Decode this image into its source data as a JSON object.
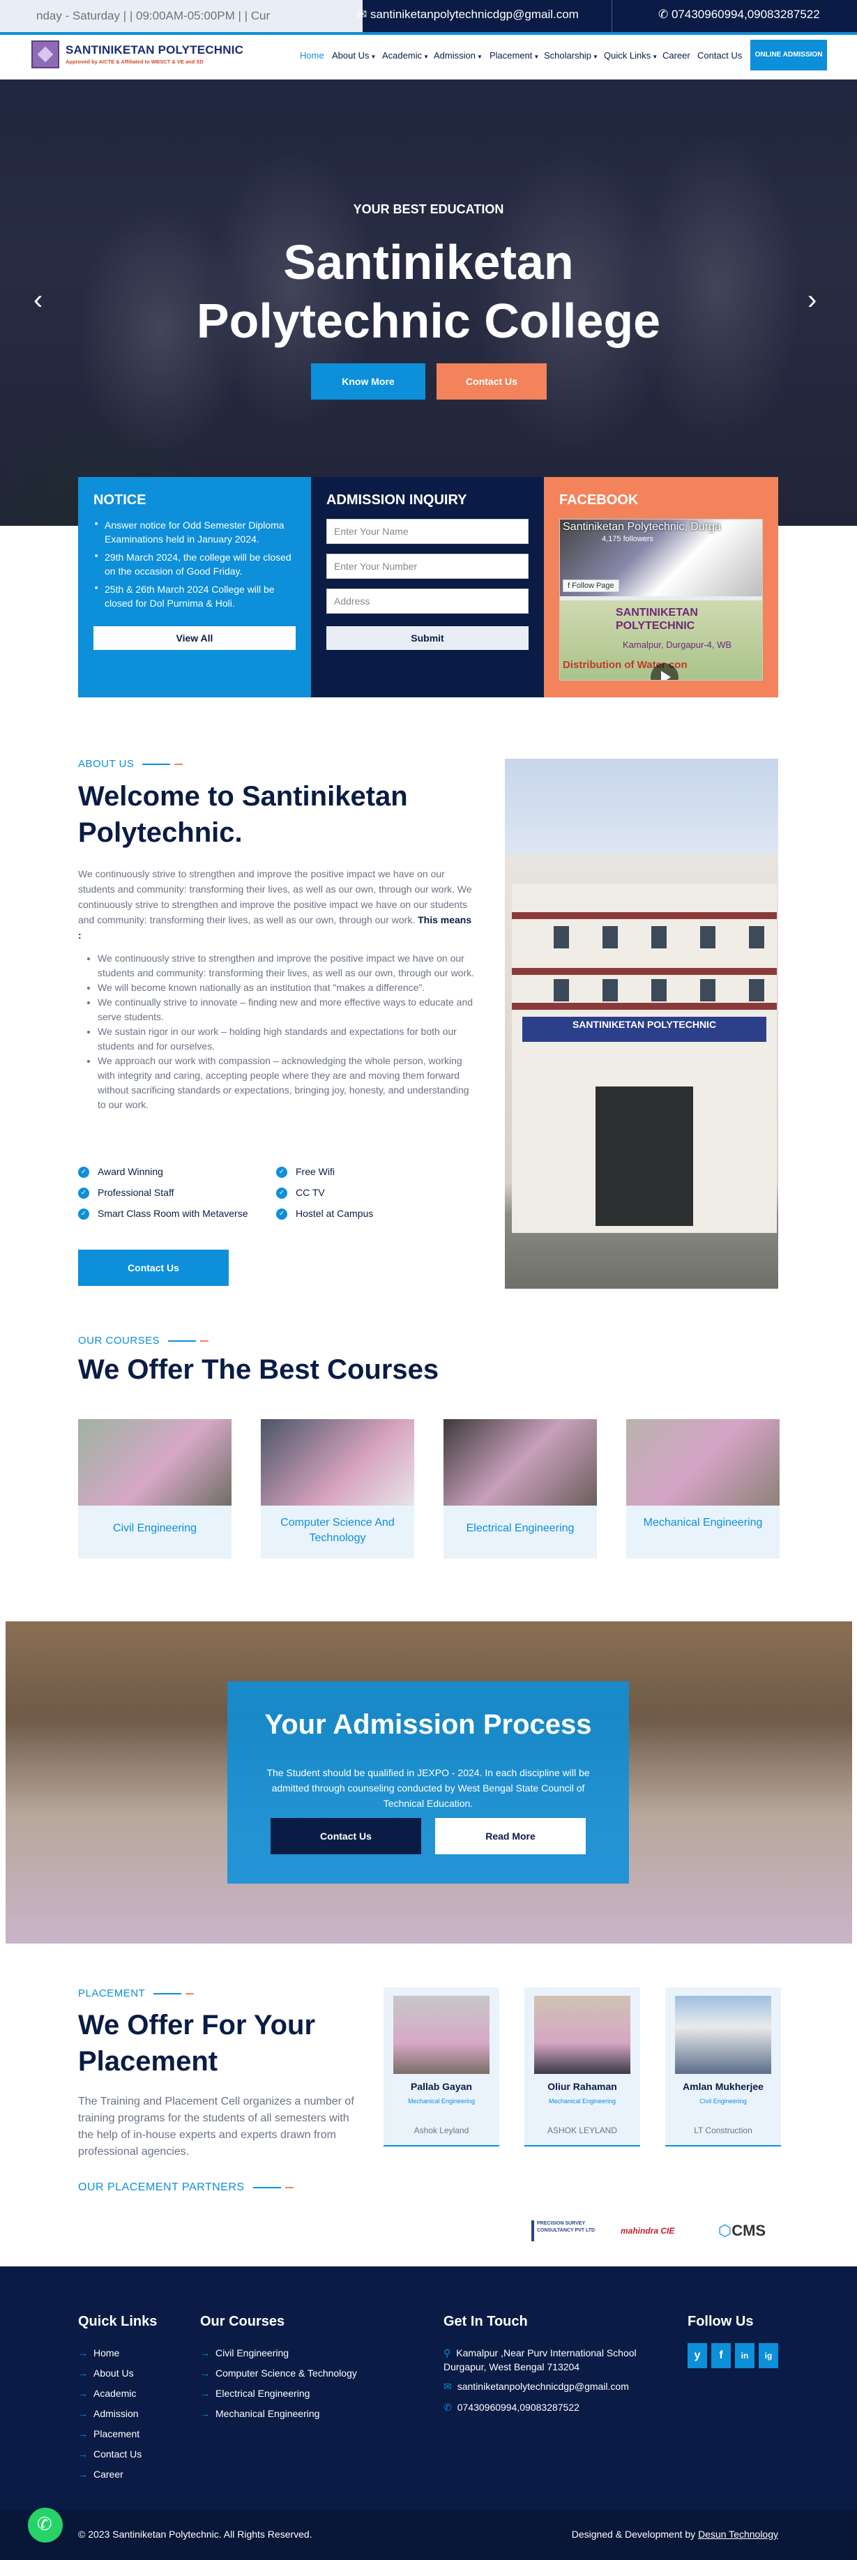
{
  "topbar": {
    "hours": "nday - Saturday | | 09:00AM-05:00PM | | Curr",
    "email": "santiniketanpolytechnicdgp@gmail.com",
    "phone": "07430960994,09083287522"
  },
  "nav": {
    "logo_title": "SANTINIKETAN POLYTECHNIC",
    "logo_sub": "Approved by AICTE & Affiliated to WBSCT & VE and SD",
    "items": [
      {
        "label": "Home"
      },
      {
        "label": "About Us"
      },
      {
        "label": "Academic"
      },
      {
        "label": "Admission"
      },
      {
        "label": "Placement"
      },
      {
        "label": "Scholarship"
      },
      {
        "label": "Quick Links"
      },
      {
        "label": "Career"
      },
      {
        "label": "Contact Us"
      }
    ],
    "cta": "ONLINE ADMISSION"
  },
  "hero": {
    "subtitle": "YOUR BEST EDUCATION",
    "title_line1": "Santiniketan",
    "title_line2": "Polytechnic College",
    "btn_know": "Know More",
    "btn_contact": "Contact Us"
  },
  "notice": {
    "heading": "NOTICE",
    "items": [
      "Answer notice for Odd Semester Diploma Examinations held in January 2024.",
      "29th March 2024, the college will be closed on the occasion of Good Friday.",
      "25th & 26th March 2024 College will be closed for Dol Purnima & Holi."
    ],
    "view_all": "View All"
  },
  "inquiry": {
    "heading": "ADMISSION INQUIRY",
    "name_placeholder": "Enter Your Name",
    "number_placeholder": "Enter Your Number",
    "address_placeholder": "Address",
    "submit": "Submit"
  },
  "facebook": {
    "heading": "FACEBOOK",
    "page_name": "Santiniketan Polytechnic, Durga",
    "followers": "4,175 followers",
    "follow_btn": "Follow Page",
    "post_title": "SANTINIKETAN POLYTECHNIC",
    "post_sub": "Kamalpur, Durgapur-4, WB",
    "post_text": "Distribution of Water con"
  },
  "about": {
    "eyebrow": "ABOUT US",
    "title_line1": "Welcome to Santiniketan",
    "title_line2": "Polytechnic.",
    "para": "We continuously strive to strengthen and improve the positive impact we have on our students and community: transforming their lives, as well as our own, through our work. We continuously strive to strengthen and improve the positive impact we have on our students and community: transforming their lives, as well as our own, through our work.",
    "para_bold": "This means :",
    "bullets": [
      "We continuously strive to strengthen and improve the positive impact we have on our students and community: transforming their lives, as well as our own, through our work.",
      "We will become known nationally as an institution that \"makes a difference\".",
      "We continually strive to innovate – finding new and more effective ways to educate and serve students.",
      "We sustain rigor in our work – holding high standards and expectations for both our students and for ourselves.",
      "We approach our work with compassion – acknowledging the whole person, working with integrity and caring, accepting people where they are and moving them forward without sacrificing standards or expectations, bringing joy, honesty, and understanding to our work."
    ],
    "features": [
      "Award Winning",
      "Free Wifi",
      "Professional Staff",
      "CC TV",
      "Smart Class Room with Metaverse",
      "Hostel at Campus"
    ],
    "btn": "Contact Us",
    "building_sign": "SANTINIKETAN POLYTECHNIC"
  },
  "courses": {
    "eyebrow": "OUR COURSES",
    "title": "We Offer The Best Courses",
    "items": [
      {
        "label": "Civil Engineering"
      },
      {
        "label": "Computer Science And Technology"
      },
      {
        "label": "Electrical Engineering"
      },
      {
        "label": "Mechanical Engineering"
      }
    ]
  },
  "admission": {
    "title": "Your Admission Process",
    "text": "The Student should be qualified in JEXPO - 2024. In each discipline will be admitted through counseling conducted by West Bengal State Council of Technical Education.",
    "btn_contact": "Contact Us",
    "btn_more": "Read More"
  },
  "placement": {
    "eyebrow": "PLACEMENT",
    "title_line1": "We Offer For Your",
    "title_line2": "Placement",
    "text": "The Training and Placement Cell organizes a number of training programs for the students of all semesters with the help of in-house experts and experts drawn from professional agencies.",
    "partners_eyebrow": "OUR PLACEMENT PARTNERS",
    "cards": [
      {
        "name": "Pallab Gayan",
        "role": "Mechanical Engineering",
        "company": "Ashok Leyland"
      },
      {
        "name": "Oliur Rahaman",
        "role": "Mechanical Engineering",
        "company": "ASHOK LEYLAND"
      },
      {
        "name": "Amlan Mukherjee",
        "role": "Civil Engineering",
        "company": "LT Construction"
      }
    ],
    "partners": [
      "PRECISION SURVEY CONSULTANCY PVT LTD",
      "mahindra CIE",
      "CMS"
    ]
  },
  "footer": {
    "quick_heading": "Quick Links",
    "quick": [
      "Home",
      "About Us",
      "Academic",
      "Admission",
      "Placement",
      "Contact Us",
      "Career"
    ],
    "courses_heading": "Our Courses",
    "courses": [
      "Civil Engineering",
      "Computer Science & Technology",
      "Electrical Engineering",
      "Mechanical Engineering"
    ],
    "touch_heading": "Get In Touch",
    "address": "Kamalpur ,Near Purv International School Durgapur, West Bengal 713204",
    "email": "santiniketanpolytechnicdgp@gmail.com",
    "phone": "07430960994,09083287522",
    "follow_heading": "Follow Us",
    "social": [
      "y",
      "f",
      "in",
      "ig"
    ],
    "copyright": "© 2023 Santiniketan Polytechnic. All Rights Reserved.",
    "credit": "Designed & Development by",
    "credit_link": "Desun Technology"
  },
  "colors": {
    "primary": "#0d8fd9",
    "navy": "#0a1c45",
    "accent": "#f2835a"
  }
}
